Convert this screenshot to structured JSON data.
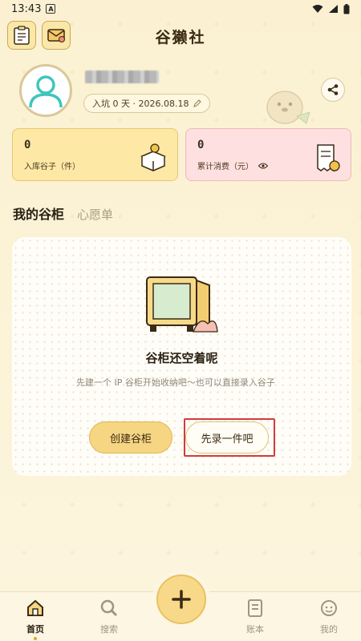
{
  "status_bar": {
    "time": "13:43"
  },
  "app": {
    "title": "谷獭社"
  },
  "profile": {
    "join_label": "入坑 0 天 · 2026.08.18"
  },
  "stats": {
    "items": {
      "value": "0",
      "label": "入库谷子（件）"
    },
    "spend": {
      "value": "0",
      "label": "累计消费（元）"
    }
  },
  "tabs": [
    {
      "label": "我的谷柜"
    },
    {
      "label": "心愿单"
    }
  ],
  "empty_state": {
    "title": "谷柜还空着呢",
    "description": "先建一个 IP 谷柜开始收纳吧～也可以直接录入谷子",
    "create_button": "创建谷柜",
    "record_button": "先录一件吧"
  },
  "bottom_nav": {
    "home": "首页",
    "search": "搜索",
    "ledger": "账本",
    "mine": "我的"
  },
  "colors": {
    "background": "#fcf4d9",
    "accent": "#f6d683",
    "highlight": "#d23b3b",
    "pink_card": "#fde0df"
  }
}
